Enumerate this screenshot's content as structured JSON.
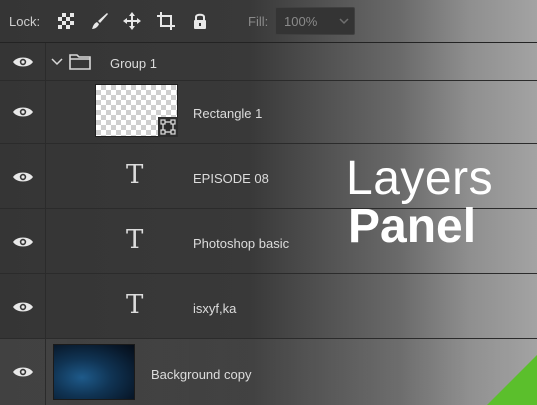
{
  "toolbar": {
    "lock_label": "Lock:",
    "lock_icons": [
      "lock-transparent-pixels-icon",
      "lock-image-pixels-icon",
      "lock-position-icon",
      "lock-artboard-icon",
      "lock-all-icon"
    ],
    "fill_label": "Fill:",
    "fill_value": "100%"
  },
  "layers": [
    {
      "name": "Group 1",
      "type": "group",
      "visible": true,
      "expanded": true
    },
    {
      "name": "Rectangle 1",
      "type": "shape",
      "visible": true
    },
    {
      "name": "EPISODE 08",
      "type": "text",
      "visible": true,
      "icon_glyph": "T"
    },
    {
      "name": "Photoshop basic",
      "type": "text",
      "visible": true,
      "icon_glyph": "T"
    },
    {
      "name": "isxyf,ka",
      "type": "text",
      "visible": true,
      "icon_glyph": "T"
    },
    {
      "name": "Background copy",
      "type": "pixel",
      "visible": true,
      "selected": true
    }
  ],
  "heading": {
    "line1": "Layers",
    "line2": "Panel"
  },
  "colors": {
    "panel_bg": "#353535",
    "text": "#dcdcdc",
    "heading_text": "#ffffff",
    "accent_corner": "#5bbf2c"
  }
}
